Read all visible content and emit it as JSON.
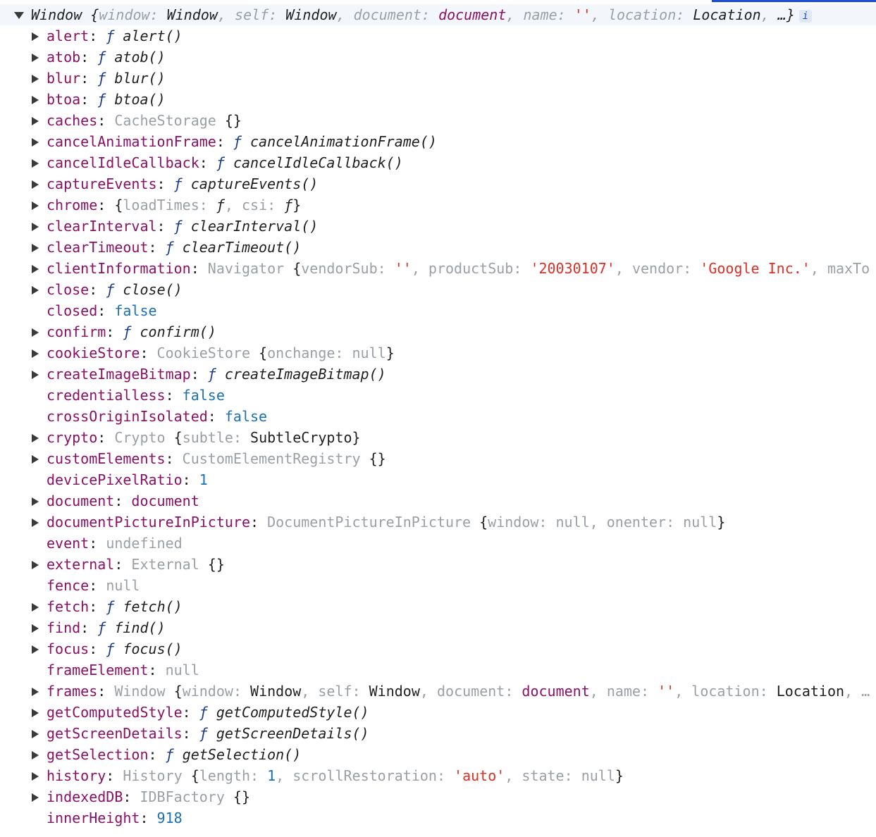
{
  "header": {
    "object_type": "Window",
    "preview": [
      {
        "key": "window",
        "value": "Window",
        "vclass": "fn"
      },
      {
        "key": "self",
        "value": "Window",
        "vclass": "fn"
      },
      {
        "key": "document",
        "value": "document",
        "vclass": "k"
      },
      {
        "key": "name",
        "value": "''",
        "vclass": "s"
      },
      {
        "key": "location",
        "value": "Location",
        "vclass": "fn"
      }
    ],
    "ellipsis": "…}",
    "info_badge": "i"
  },
  "rows": [
    {
      "expandable": true,
      "key": "alert",
      "parts": [
        {
          "t": "ƒ ",
          "c": "f"
        },
        {
          "t": "alert()",
          "c": "fn"
        }
      ]
    },
    {
      "expandable": true,
      "key": "atob",
      "parts": [
        {
          "t": "ƒ ",
          "c": "f"
        },
        {
          "t": "atob()",
          "c": "fn"
        }
      ]
    },
    {
      "expandable": true,
      "key": "blur",
      "parts": [
        {
          "t": "ƒ ",
          "c": "f"
        },
        {
          "t": "blur()",
          "c": "fn"
        }
      ]
    },
    {
      "expandable": true,
      "key": "btoa",
      "parts": [
        {
          "t": "ƒ ",
          "c": "f"
        },
        {
          "t": "btoa()",
          "c": "fn"
        }
      ]
    },
    {
      "expandable": true,
      "key": "caches",
      "parts": [
        {
          "t": "CacheStorage ",
          "c": "g"
        },
        {
          "t": "{}",
          "c": "p"
        }
      ]
    },
    {
      "expandable": true,
      "key": "cancelAnimationFrame",
      "parts": [
        {
          "t": "ƒ ",
          "c": "f"
        },
        {
          "t": "cancelAnimationFrame()",
          "c": "fn"
        }
      ]
    },
    {
      "expandable": true,
      "key": "cancelIdleCallback",
      "parts": [
        {
          "t": "ƒ ",
          "c": "f"
        },
        {
          "t": "cancelIdleCallback()",
          "c": "fn"
        }
      ]
    },
    {
      "expandable": true,
      "key": "captureEvents",
      "parts": [
        {
          "t": "ƒ ",
          "c": "f"
        },
        {
          "t": "captureEvents()",
          "c": "fn"
        }
      ]
    },
    {
      "expandable": true,
      "key": "chrome",
      "parts": [
        {
          "t": "{",
          "c": "p"
        },
        {
          "t": "loadTimes",
          "c": "g"
        },
        {
          "t": ": ",
          "c": "g"
        },
        {
          "t": "ƒ",
          "c": "fn"
        },
        {
          "t": ", ",
          "c": "g"
        },
        {
          "t": "csi",
          "c": "g"
        },
        {
          "t": ": ",
          "c": "g"
        },
        {
          "t": "ƒ",
          "c": "fn"
        },
        {
          "t": "}",
          "c": "p"
        }
      ]
    },
    {
      "expandable": true,
      "key": "clearInterval",
      "parts": [
        {
          "t": "ƒ ",
          "c": "f"
        },
        {
          "t": "clearInterval()",
          "c": "fn"
        }
      ]
    },
    {
      "expandable": true,
      "key": "clearTimeout",
      "parts": [
        {
          "t": "ƒ ",
          "c": "f"
        },
        {
          "t": "clearTimeout()",
          "c": "fn"
        }
      ]
    },
    {
      "expandable": true,
      "key": "clientInformation",
      "parts": [
        {
          "t": "Navigator ",
          "c": "g"
        },
        {
          "t": "{",
          "c": "p"
        },
        {
          "t": "vendorSub",
          "c": "g"
        },
        {
          "t": ": ",
          "c": "g"
        },
        {
          "t": "''",
          "c": "s"
        },
        {
          "t": ", ",
          "c": "g"
        },
        {
          "t": "productSub",
          "c": "g"
        },
        {
          "t": ": ",
          "c": "g"
        },
        {
          "t": "'20030107'",
          "c": "s"
        },
        {
          "t": ", ",
          "c": "g"
        },
        {
          "t": "vendor",
          "c": "g"
        },
        {
          "t": ": ",
          "c": "g"
        },
        {
          "t": "'Google Inc.'",
          "c": "s"
        },
        {
          "t": ", ",
          "c": "g"
        },
        {
          "t": "maxTo",
          "c": "g"
        }
      ]
    },
    {
      "expandable": true,
      "key": "close",
      "parts": [
        {
          "t": "ƒ ",
          "c": "f"
        },
        {
          "t": "close()",
          "c": "fn"
        }
      ]
    },
    {
      "expandable": false,
      "key": "closed",
      "parts": [
        {
          "t": "false",
          "c": "b"
        }
      ]
    },
    {
      "expandable": true,
      "key": "confirm",
      "parts": [
        {
          "t": "ƒ ",
          "c": "f"
        },
        {
          "t": "confirm()",
          "c": "fn"
        }
      ]
    },
    {
      "expandable": true,
      "key": "cookieStore",
      "parts": [
        {
          "t": "CookieStore ",
          "c": "g"
        },
        {
          "t": "{",
          "c": "p"
        },
        {
          "t": "onchange",
          "c": "g"
        },
        {
          "t": ": ",
          "c": "g"
        },
        {
          "t": "null",
          "c": "g"
        },
        {
          "t": "}",
          "c": "p"
        }
      ]
    },
    {
      "expandable": true,
      "key": "createImageBitmap",
      "parts": [
        {
          "t": "ƒ ",
          "c": "f"
        },
        {
          "t": "createImageBitmap()",
          "c": "fn"
        }
      ]
    },
    {
      "expandable": false,
      "key": "credentialless",
      "parts": [
        {
          "t": "false",
          "c": "b"
        }
      ]
    },
    {
      "expandable": false,
      "key": "crossOriginIsolated",
      "parts": [
        {
          "t": "false",
          "c": "b"
        }
      ]
    },
    {
      "expandable": true,
      "key": "crypto",
      "parts": [
        {
          "t": "Crypto ",
          "c": "g"
        },
        {
          "t": "{",
          "c": "p"
        },
        {
          "t": "subtle",
          "c": "g"
        },
        {
          "t": ": ",
          "c": "g"
        },
        {
          "t": "SubtleCrypto",
          "c": "p"
        },
        {
          "t": "}",
          "c": "p"
        }
      ]
    },
    {
      "expandable": true,
      "key": "customElements",
      "parts": [
        {
          "t": "CustomElementRegistry ",
          "c": "g"
        },
        {
          "t": "{}",
          "c": "p"
        }
      ]
    },
    {
      "expandable": false,
      "key": "devicePixelRatio",
      "parts": [
        {
          "t": "1",
          "c": "b"
        }
      ]
    },
    {
      "expandable": true,
      "key": "document",
      "parts": [
        {
          "t": "document",
          "c": "k"
        }
      ]
    },
    {
      "expandable": true,
      "key": "documentPictureInPicture",
      "parts": [
        {
          "t": "DocumentPictureInPicture ",
          "c": "g"
        },
        {
          "t": "{",
          "c": "p"
        },
        {
          "t": "window",
          "c": "g"
        },
        {
          "t": ": ",
          "c": "g"
        },
        {
          "t": "null",
          "c": "g"
        },
        {
          "t": ", ",
          "c": "g"
        },
        {
          "t": "onenter",
          "c": "g"
        },
        {
          "t": ": ",
          "c": "g"
        },
        {
          "t": "null",
          "c": "g"
        },
        {
          "t": "}",
          "c": "p"
        }
      ]
    },
    {
      "expandable": false,
      "key": "event",
      "parts": [
        {
          "t": "undefined",
          "c": "g"
        }
      ]
    },
    {
      "expandable": true,
      "key": "external",
      "parts": [
        {
          "t": "External ",
          "c": "g"
        },
        {
          "t": "{}",
          "c": "p"
        }
      ]
    },
    {
      "expandable": false,
      "key": "fence",
      "parts": [
        {
          "t": "null",
          "c": "g"
        }
      ]
    },
    {
      "expandable": true,
      "key": "fetch",
      "parts": [
        {
          "t": "ƒ ",
          "c": "f"
        },
        {
          "t": "fetch()",
          "c": "fn"
        }
      ]
    },
    {
      "expandable": true,
      "key": "find",
      "parts": [
        {
          "t": "ƒ ",
          "c": "f"
        },
        {
          "t": "find()",
          "c": "fn"
        }
      ]
    },
    {
      "expandable": true,
      "key": "focus",
      "parts": [
        {
          "t": "ƒ ",
          "c": "f"
        },
        {
          "t": "focus()",
          "c": "fn"
        }
      ]
    },
    {
      "expandable": false,
      "key": "frameElement",
      "parts": [
        {
          "t": "null",
          "c": "g"
        }
      ]
    },
    {
      "expandable": true,
      "key": "frames",
      "parts": [
        {
          "t": "Window ",
          "c": "g"
        },
        {
          "t": "{",
          "c": "p"
        },
        {
          "t": "window",
          "c": "g"
        },
        {
          "t": ": ",
          "c": "g"
        },
        {
          "t": "Window",
          "c": "p"
        },
        {
          "t": ", ",
          "c": "g"
        },
        {
          "t": "self",
          "c": "g"
        },
        {
          "t": ": ",
          "c": "g"
        },
        {
          "t": "Window",
          "c": "p"
        },
        {
          "t": ", ",
          "c": "g"
        },
        {
          "t": "document",
          "c": "g"
        },
        {
          "t": ": ",
          "c": "g"
        },
        {
          "t": "document",
          "c": "k"
        },
        {
          "t": ", ",
          "c": "g"
        },
        {
          "t": "name",
          "c": "g"
        },
        {
          "t": ": ",
          "c": "g"
        },
        {
          "t": "''",
          "c": "s"
        },
        {
          "t": ", ",
          "c": "g"
        },
        {
          "t": "location",
          "c": "g"
        },
        {
          "t": ": ",
          "c": "g"
        },
        {
          "t": "Location",
          "c": "p"
        },
        {
          "t": ", …",
          "c": "g"
        }
      ]
    },
    {
      "expandable": true,
      "key": "getComputedStyle",
      "parts": [
        {
          "t": "ƒ ",
          "c": "f"
        },
        {
          "t": "getComputedStyle()",
          "c": "fn"
        }
      ]
    },
    {
      "expandable": true,
      "key": "getScreenDetails",
      "parts": [
        {
          "t": "ƒ ",
          "c": "f"
        },
        {
          "t": "getScreenDetails()",
          "c": "fn"
        }
      ]
    },
    {
      "expandable": true,
      "key": "getSelection",
      "parts": [
        {
          "t": "ƒ ",
          "c": "f"
        },
        {
          "t": "getSelection()",
          "c": "fn"
        }
      ]
    },
    {
      "expandable": true,
      "key": "history",
      "parts": [
        {
          "t": "History ",
          "c": "g"
        },
        {
          "t": "{",
          "c": "p"
        },
        {
          "t": "length",
          "c": "g"
        },
        {
          "t": ": ",
          "c": "g"
        },
        {
          "t": "1",
          "c": "b"
        },
        {
          "t": ", ",
          "c": "g"
        },
        {
          "t": "scrollRestoration",
          "c": "g"
        },
        {
          "t": ": ",
          "c": "g"
        },
        {
          "t": "'auto'",
          "c": "s"
        },
        {
          "t": ", ",
          "c": "g"
        },
        {
          "t": "state",
          "c": "g"
        },
        {
          "t": ": ",
          "c": "g"
        },
        {
          "t": "null",
          "c": "g"
        },
        {
          "t": "}",
          "c": "p"
        }
      ]
    },
    {
      "expandable": true,
      "key": "indexedDB",
      "parts": [
        {
          "t": "IDBFactory ",
          "c": "g"
        },
        {
          "t": "{}",
          "c": "p"
        }
      ]
    },
    {
      "expandable": false,
      "key": "innerHeight",
      "parts": [
        {
          "t": "918",
          "c": "b"
        }
      ]
    }
  ],
  "colors": {
    "key": "#8a1065",
    "muted": "#9aa0a6",
    "string": "#d93025",
    "number": "#1a6fb6",
    "header_bg": "#f3f6fb",
    "accent_line": "#1a4fd6"
  }
}
